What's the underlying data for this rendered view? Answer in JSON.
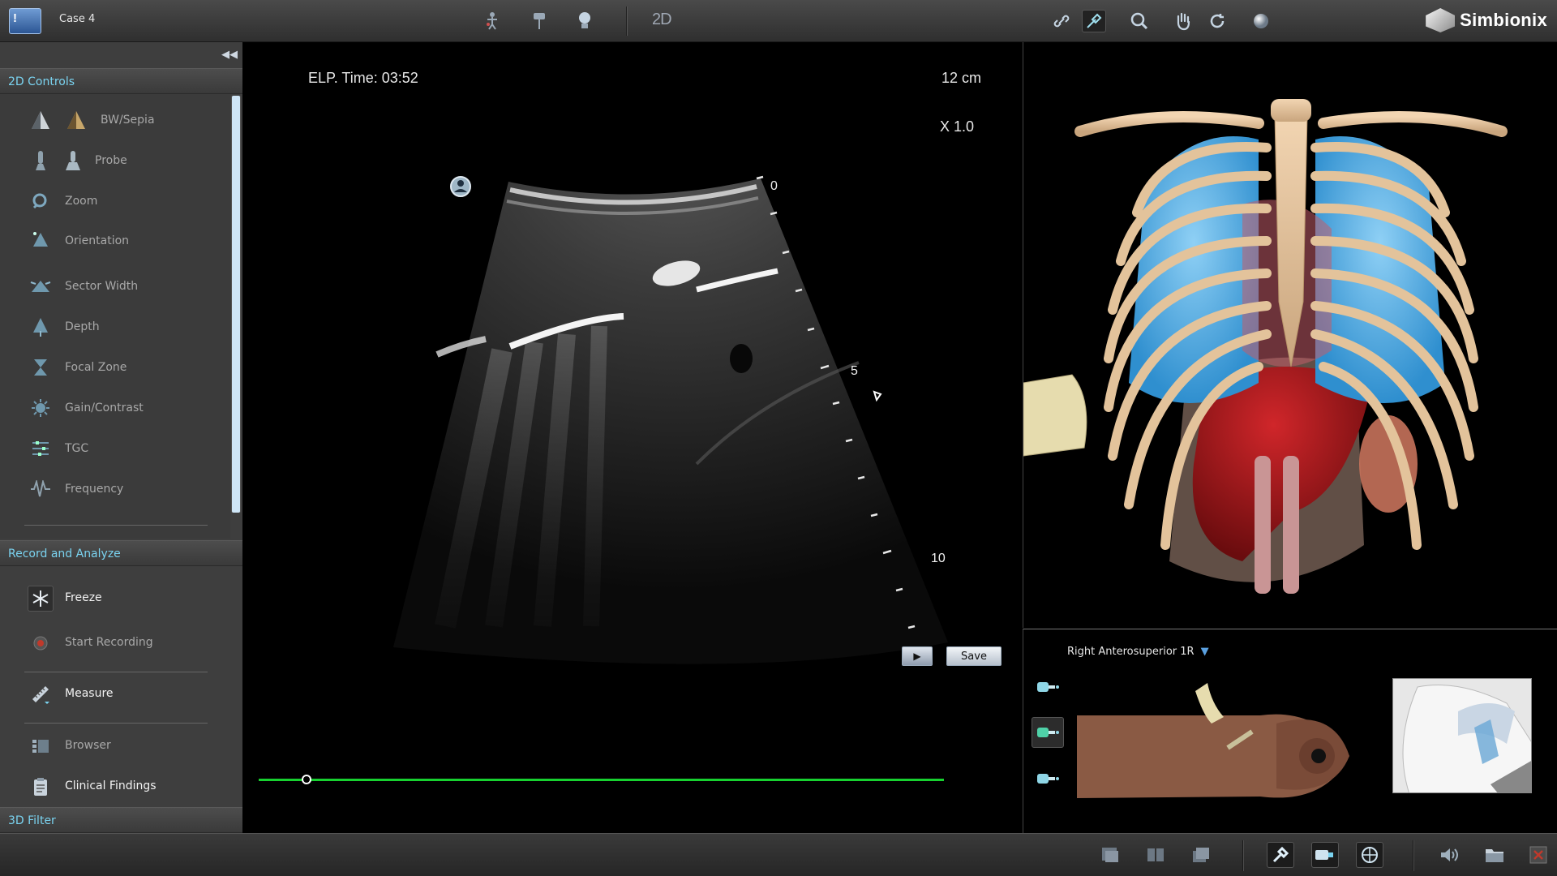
{
  "window": {
    "case_title": "Case 4",
    "app_logo_text": "!",
    "brand": "Simbionix",
    "mode_label": "2D"
  },
  "toolbar": {
    "left_icons": [
      "skeleton-view-icon",
      "pin-icon",
      "lightbulb-icon"
    ],
    "right_icons": [
      "link-icon",
      "probe-link-icon",
      "magnify-icon",
      "hand-icon",
      "rotate-icon",
      "sphere-icon"
    ]
  },
  "left_panel": {
    "collapse_icon": "double-chevron-left-icon",
    "sections": {
      "controls_2d": "2D Controls",
      "record_analyze": "Record and Analyze",
      "filter_3d": "3D Filter"
    },
    "controls": [
      {
        "label": "BW/Sepia",
        "icon": "sector-bw-icon"
      },
      {
        "label": "Probe",
        "icon": "probe-icon"
      },
      {
        "label": "Zoom",
        "icon": "zoom-icon"
      },
      {
        "label": "Orientation",
        "icon": "orientation-icon"
      },
      {
        "label": "Sector Width",
        "icon": "sector-width-icon"
      },
      {
        "label": "Depth",
        "icon": "depth-icon"
      },
      {
        "label": "Focal Zone",
        "icon": "focal-zone-icon"
      },
      {
        "label": "Gain/Contrast",
        "icon": "gain-icon"
      },
      {
        "label": "TGC",
        "icon": "tgc-icon"
      },
      {
        "label": "Frequency",
        "icon": "frequency-icon"
      }
    ],
    "record": [
      {
        "label": "Freeze",
        "icon": "snowflake-icon"
      },
      {
        "label": "Start Recording",
        "icon": "record-icon"
      },
      {
        "label": "Measure",
        "icon": "ruler-icon"
      },
      {
        "label": "Browser",
        "icon": "browser-icon"
      },
      {
        "label": "Clinical Findings",
        "icon": "clipboard-icon"
      }
    ]
  },
  "ultrasound": {
    "elp_time": "ELP. Time: 03:52",
    "depth": "12 cm",
    "zoom": "X 1.0",
    "scale_labels": [
      "0",
      "5",
      "10"
    ],
    "save_label": "Save",
    "play_icon": "play-icon",
    "timeline_position": 0.07,
    "accent_green": "#17d130"
  },
  "probe_panel": {
    "position_label": "Right Anterosuperior 1R",
    "dropdown_icon": "triangle-down-icon",
    "probe_buttons": [
      "probe-type-1-icon",
      "probe-type-2-icon",
      "probe-type-3-icon"
    ]
  },
  "bottom_bar": {
    "icons": [
      "single-view-icon",
      "split-view-icon",
      "overlay-view-icon",
      "probe-tool-icon",
      "camera-probe-icon",
      "target-icon",
      "volume-icon",
      "folder-icon",
      "close-icon"
    ]
  },
  "colors": {
    "section_header_text": "#7ad3f0",
    "accent_blue": "#5aa0e0"
  }
}
